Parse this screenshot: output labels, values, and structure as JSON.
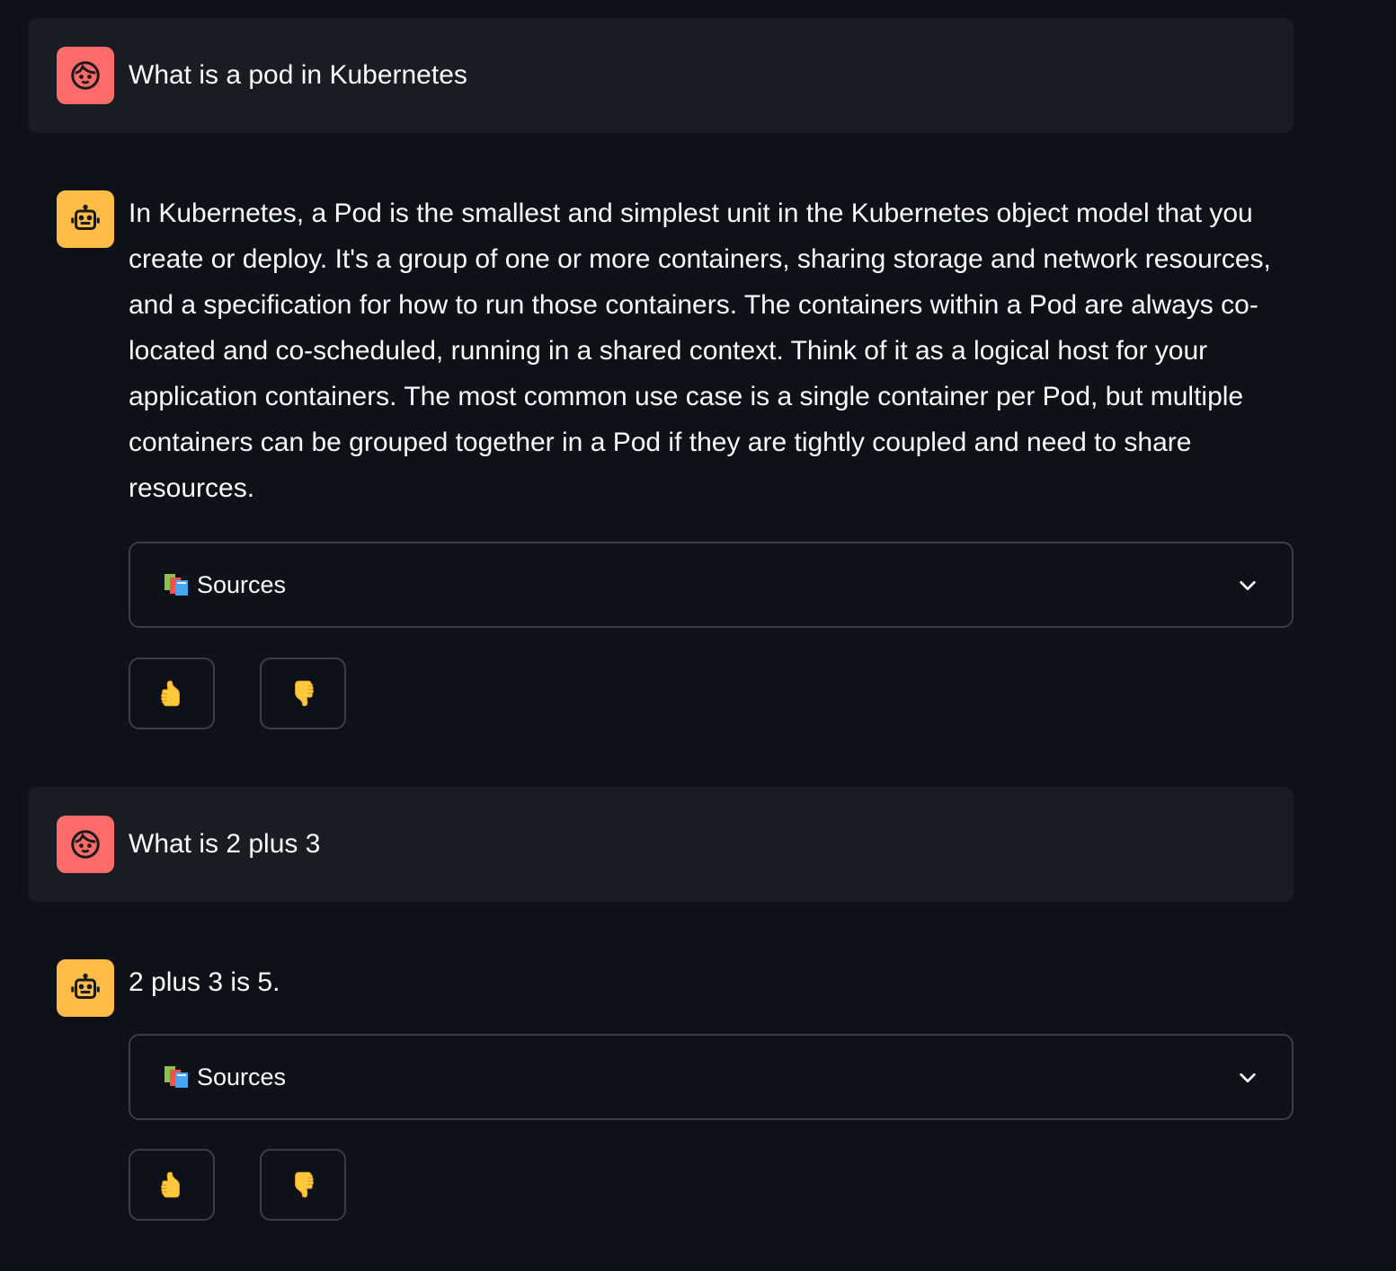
{
  "messages": [
    {
      "role": "user",
      "text": "What is a pod in Kubernetes"
    },
    {
      "role": "assistant",
      "text": "In Kubernetes, a Pod is the smallest and simplest unit in the Kubernetes object model that you create or deploy. It's a group of one or more containers, sharing storage and network resources, and a specification for how to run those containers. The containers within a Pod are always co-located and co-scheduled, running in a shared context. Think of it as a logical host for your application containers. The most common use case is a single container per Pod, but multiple containers can be grouped together in a Pod if they are tightly coupled and need to share resources.",
      "sources_label": "Sources"
    },
    {
      "role": "user",
      "text": "What is 2 plus 3"
    },
    {
      "role": "assistant",
      "text": "2 plus 3 is 5.",
      "sources_label": "Sources"
    }
  ],
  "icons": {
    "user_avatar": "face-icon",
    "assistant_avatar": "robot-icon",
    "sources": "books-icon",
    "expand": "chevron-down-icon",
    "like": "thumbs-up-icon",
    "dislike": "thumbs-down-icon"
  },
  "colors": {
    "background": "#0e1117",
    "user_bubble": "#1a1c24",
    "user_avatar": "#ff6b6b",
    "assistant_avatar": "#ffbd45",
    "border": "#3a3d47"
  }
}
